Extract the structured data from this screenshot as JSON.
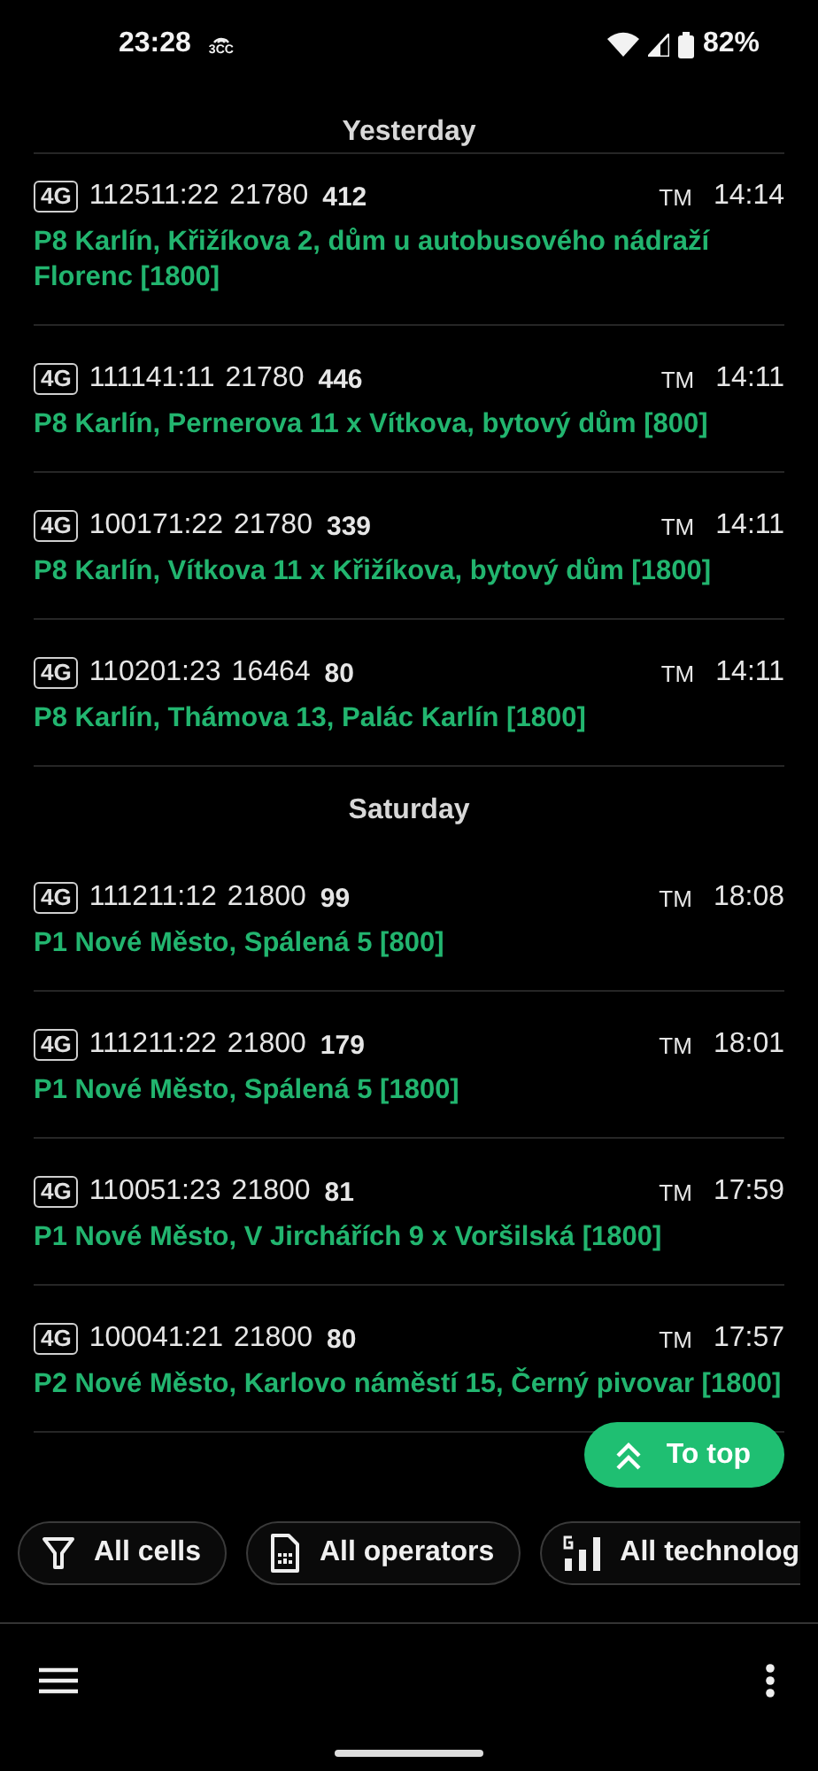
{
  "status_bar": {
    "time": "23:28",
    "indicator": "3CC",
    "battery": "82%"
  },
  "groups": [
    {
      "title": "Yesterday",
      "cells": [
        {
          "tech": "4G",
          "cell_id": "112511:22",
          "tac": "21780",
          "pci": "412",
          "operator": "TM",
          "time": "14:14",
          "location": "P8 Karlín, Křižíkova 2, dům u autobusového nádraží Florenc [1800]"
        },
        {
          "tech": "4G",
          "cell_id": "111141:11",
          "tac": "21780",
          "pci": "446",
          "operator": "TM",
          "time": "14:11",
          "location": "P8 Karlín, Pernerova 11 x Vítkova, bytový dům [800]"
        },
        {
          "tech": "4G",
          "cell_id": "100171:22",
          "tac": "21780",
          "pci": "339",
          "operator": "TM",
          "time": "14:11",
          "location": "P8 Karlín, Vítkova 11 x Křižíkova, bytový dům [1800]"
        },
        {
          "tech": "4G",
          "cell_id": "110201:23",
          "tac": "16464",
          "pci": "80",
          "operator": "TM",
          "time": "14:11",
          "location": "P8 Karlín, Thámova 13, Palác Karlín [1800]"
        }
      ]
    },
    {
      "title": "Saturday",
      "cells": [
        {
          "tech": "4G",
          "cell_id": "111211:12",
          "tac": "21800",
          "pci": "99",
          "operator": "TM",
          "time": "18:08",
          "location": "P1 Nové Město, Spálená 5 [800]"
        },
        {
          "tech": "4G",
          "cell_id": "111211:22",
          "tac": "21800",
          "pci": "179",
          "operator": "TM",
          "time": "18:01",
          "location": "P1 Nové Město, Spálená 5 [1800]"
        },
        {
          "tech": "4G",
          "cell_id": "110051:23",
          "tac": "21800",
          "pci": "81",
          "operator": "TM",
          "time": "17:59",
          "location": "P1 Nové Město, V Jirchářích 9 x Voršilská [1800]"
        },
        {
          "tech": "4G",
          "cell_id": "100041:21",
          "tac": "21800",
          "pci": "80",
          "operator": "TM",
          "time": "17:57",
          "location": "P2 Nové Město, Karlovo náměstí 15, Černý pivovar [1800]"
        }
      ]
    }
  ],
  "fab": {
    "label": "To top"
  },
  "filters": [
    {
      "label": "All cells",
      "kind": "filter"
    },
    {
      "label": "All operators",
      "kind": "sim"
    },
    {
      "label": "All technolog",
      "kind": "signal"
    }
  ]
}
